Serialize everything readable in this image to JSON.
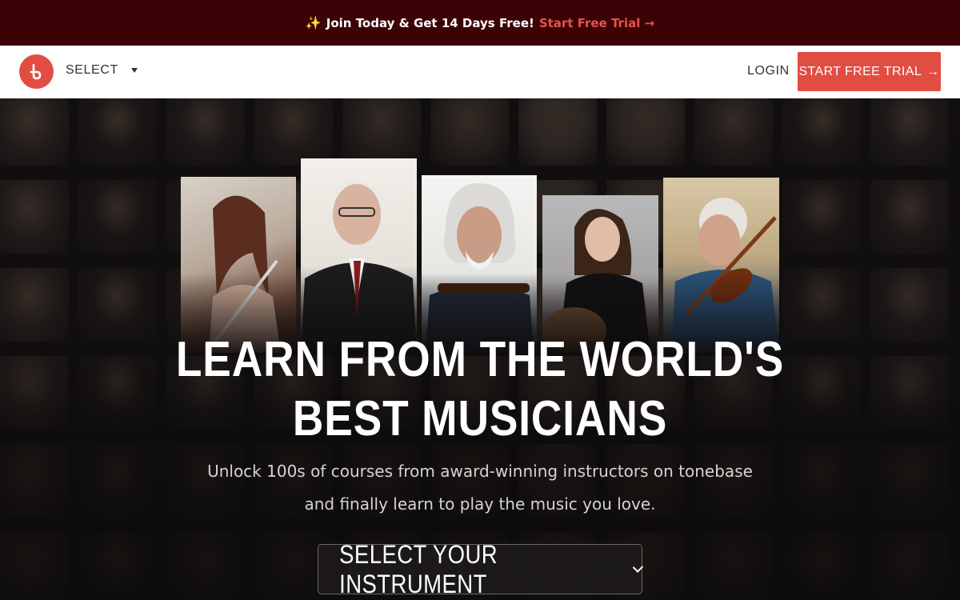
{
  "promo": {
    "sparkle_icon": "sparkles-icon",
    "text": "Join Today & Get 14 Days Free!",
    "link": "Start Free Trial →"
  },
  "header": {
    "logo_icon": "tonebase-logo-icon",
    "select_label": "SELECT",
    "login_label": "LOGIN",
    "cta_label": "START FREE TRIAL",
    "cta_arrow": "→"
  },
  "hero": {
    "headline_line1": "LEARN FROM THE WORLD'S",
    "headline_line2": "BEST MUSICIANS",
    "subtext_line1": "Unlock 100s of courses from award-winning instructors on tonebase",
    "subtext_line2": "and finally learn to play the music you love.",
    "instrument_select_label": "SELECT YOUR INSTRUMENT"
  },
  "colors": {
    "promo_bg": "#3b0306",
    "accent": "#e14d43",
    "header_bg": "#ffffff",
    "hero_bg": "#141111"
  }
}
